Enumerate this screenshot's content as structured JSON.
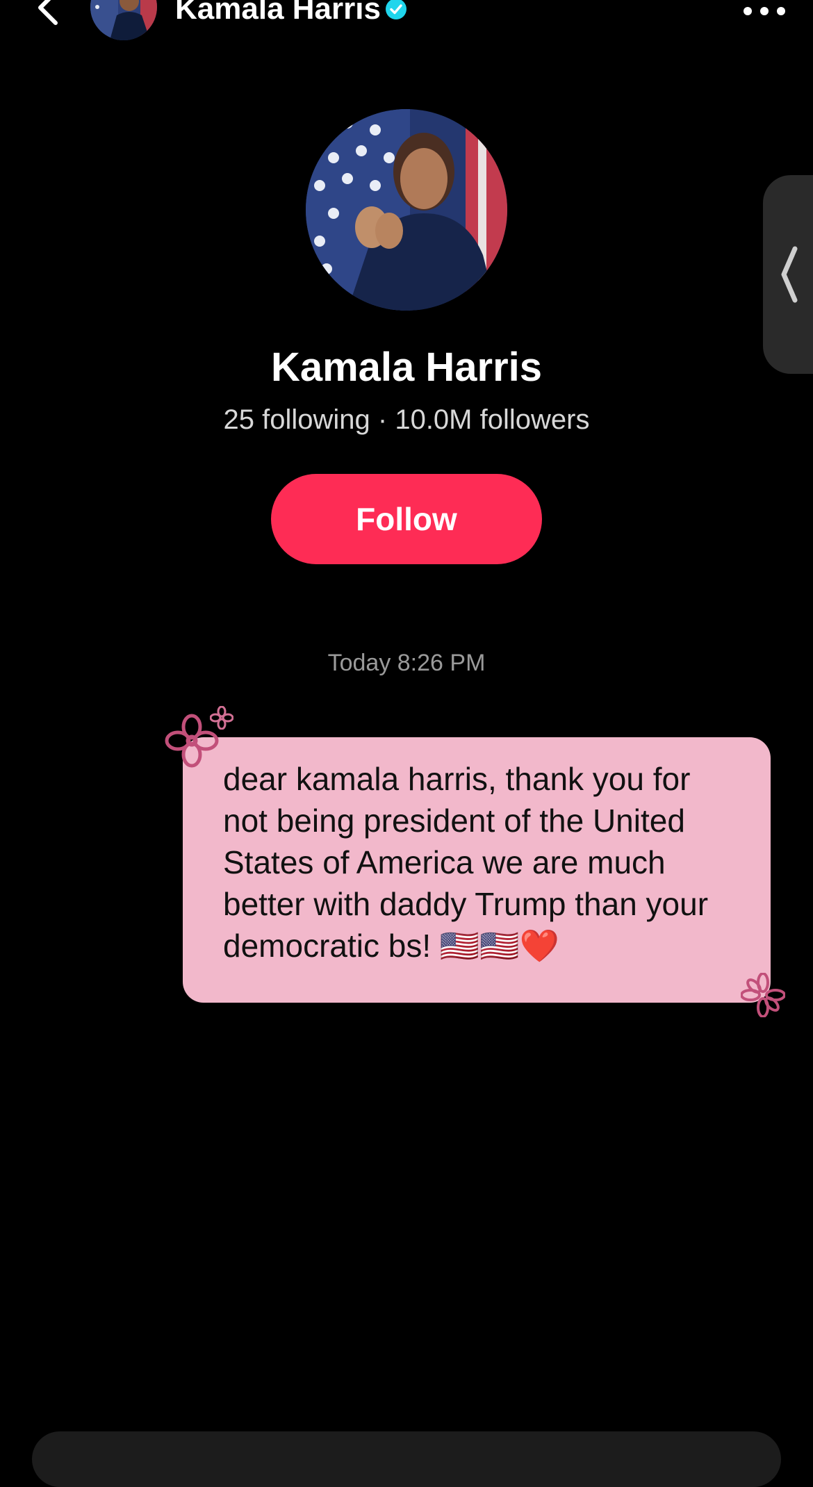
{
  "header": {
    "title": "Kamala Harris",
    "back_icon": "chevron-left-icon",
    "verified_icon": "verified-badge-icon",
    "more_icon": "more-horizontal-icon"
  },
  "profile": {
    "name": "Kamala Harris",
    "stats": "25 following · 10.0M followers",
    "follow_label": "Follow"
  },
  "side_panel": {
    "icon": "chevron-left-icon"
  },
  "chat": {
    "timestamp": "Today 8:26 PM",
    "messages": [
      {
        "direction": "outgoing",
        "text": "dear kamala harris, thank you for not being president of the United States of America we are much better with daddy Trump than your democratic bs! 🇺🇸🇺🇸❤️"
      }
    ]
  },
  "colors": {
    "background": "#000000",
    "follow_button": "#fe2c55",
    "bubble": "#f2b8cb",
    "verified": "#20d5ec",
    "flower": "#c2507a"
  }
}
